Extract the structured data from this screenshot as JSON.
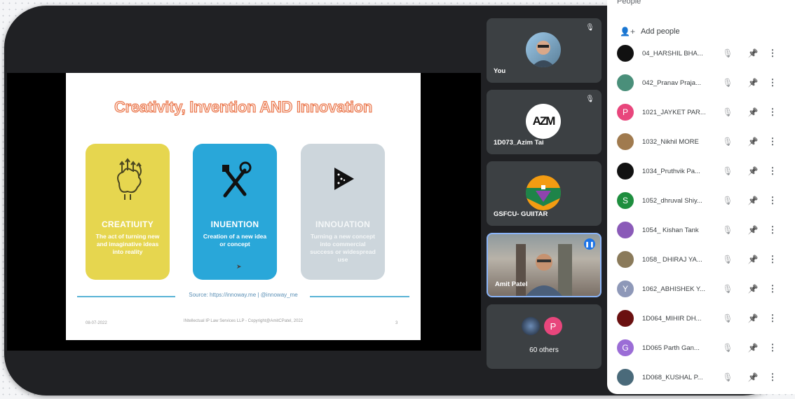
{
  "slide": {
    "title": "Creativity, Invention AND Innovation",
    "cards": [
      {
        "heading": "CREATIUITY",
        "desc": "The act of turning new and imaginative ideas into reality",
        "icon": "brain-icon"
      },
      {
        "heading": "INUENTION",
        "desc": "Creation of a new idea or concept",
        "icon": "tools-icon"
      },
      {
        "heading": "INNOUATION",
        "desc": "Turning a new concept into commercial success or widespread use",
        "icon": "megaphone-icon"
      }
    ],
    "source": "Source: https://innoway.me | @innoway_me",
    "date": "08-07-2022",
    "copyright": "INtellectual IP Law Services LLP - Copyright@AmitCPatel, 2022",
    "page": "3"
  },
  "tiles": [
    {
      "name": "You"
    },
    {
      "name": "1D073_Azim Tai",
      "avatar_text": "AZM"
    },
    {
      "name": "GSFCU- GUIITAR"
    },
    {
      "name": "Amit Patel"
    },
    {
      "name": "60 others",
      "avatar_text": "P"
    }
  ],
  "panel": {
    "header": "People",
    "add_people": "Add people",
    "participants": [
      {
        "name": "04_HARSHIL BHA...",
        "color": "#111111",
        "initial": ""
      },
      {
        "name": "042_Pranav Praja...",
        "color": "#4a8f7a",
        "initial": ""
      },
      {
        "name": "1021_JAYKET PAR...",
        "color": "#e8467c",
        "initial": "P"
      },
      {
        "name": "1032_Nikhil MORE",
        "color": "#a07a4e",
        "initial": ""
      },
      {
        "name": "1034_Pruthvik Pa...",
        "color": "#111111",
        "initial": ""
      },
      {
        "name": "1052_dhruval Shiy...",
        "color": "#1e8e3e",
        "initial": "S"
      },
      {
        "name": "1054_ Kishan Tank",
        "color": "#8a5ab8",
        "initial": ""
      },
      {
        "name": "1058_ DHIRAJ YA...",
        "color": "#8a7a5a",
        "initial": ""
      },
      {
        "name": "1062_ABHISHEK Y...",
        "color": "#8e98b8",
        "initial": "Y"
      },
      {
        "name": "1D064_MIHIR DH...",
        "color": "#6a1010",
        "initial": ""
      },
      {
        "name": "1D065 Parth Gan...",
        "color": "#9b6dd6",
        "initial": "G"
      },
      {
        "name": "1D068_KUSHAL P...",
        "color": "#4a6a7a",
        "initial": ""
      }
    ]
  }
}
